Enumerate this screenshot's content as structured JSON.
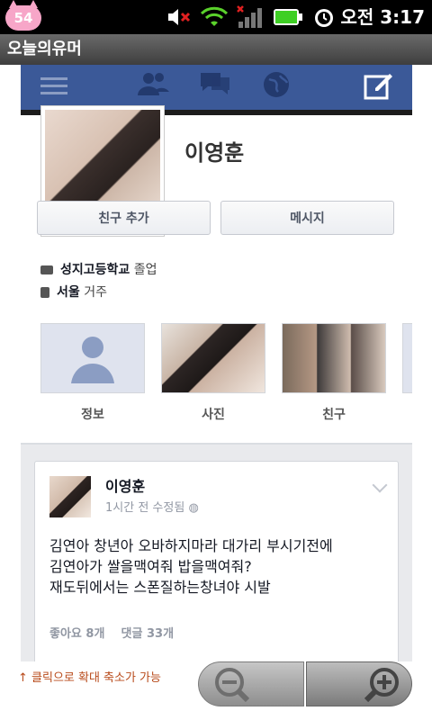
{
  "status_bar": {
    "badge_count": "54",
    "time": "오전 3:17",
    "icons": [
      "mute-icon",
      "wifi-icon",
      "signal-icon",
      "battery-icon",
      "alarm-icon"
    ]
  },
  "app": {
    "title": "오늘의유머"
  },
  "facebook": {
    "nav_icons": [
      "menu-icon",
      "friends-icon",
      "messages-icon",
      "globe-icon",
      "compose-icon"
    ],
    "profile": {
      "name": "이영훈",
      "add_friend_label": "친구 추가",
      "message_label": "메시지",
      "school": "성지고등학교",
      "school_suffix": "졸업",
      "city": "서울",
      "city_suffix": "거주"
    },
    "tiles": [
      {
        "label": "정보"
      },
      {
        "label": "사진"
      },
      {
        "label": "친구"
      }
    ],
    "post": {
      "author": "이영훈",
      "meta": "1시간 전 수정됨",
      "lines": [
        "김연아 창년아 오바하지마라 대가리 부시기전에",
        "김연아가 쌀을맥여줘 밥을맥여줘?",
        "재도뒤에서는 스폰질하는창녀야 시발"
      ],
      "likes": "좋아요 8개",
      "comments": "댓글 33개"
    }
  },
  "hint_text": "↑ 클릭으로 확대 축소가 가능",
  "colors": {
    "fb_blue": "#3b5998",
    "statusbar": "#000000",
    "hint": "#b84a1a"
  }
}
